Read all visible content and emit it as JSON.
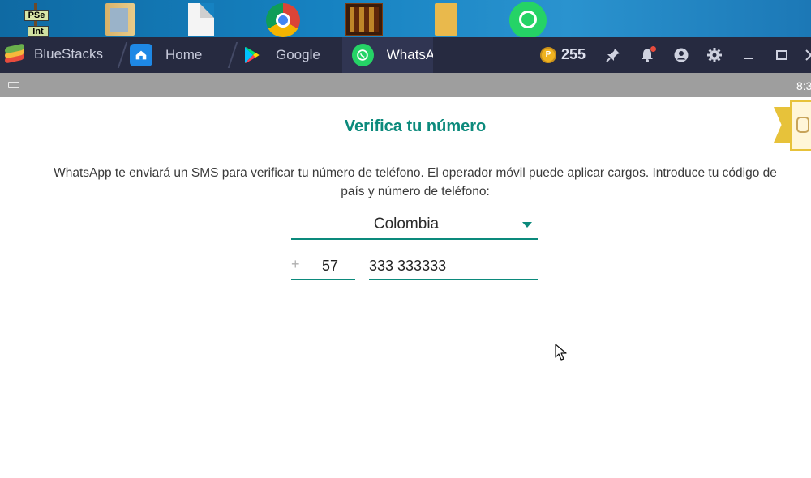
{
  "desktop": {
    "icons": [
      {
        "name": "pse-icon",
        "plate_top": "PSe",
        "plate_bottom": "Int"
      },
      {
        "name": "book-icon"
      },
      {
        "name": "file-icon"
      },
      {
        "name": "chrome-icon"
      },
      {
        "name": "game-icon"
      },
      {
        "name": "folder-icon"
      },
      {
        "name": "whatsapp-icon"
      }
    ]
  },
  "titlebar": {
    "app_name": "BlueStacks",
    "tabs": [
      {
        "label": "Home",
        "icon": "home-icon"
      },
      {
        "label": "Google",
        "icon": "play-store-icon"
      },
      {
        "label": "WhatsApp",
        "icon": "whatsapp-icon",
        "active": true
      }
    ],
    "coin_symbol": "P",
    "coins": "255",
    "icons": [
      "pin-icon",
      "bell-icon",
      "account-icon",
      "gear-icon",
      "minimize-icon",
      "maximize-icon",
      "close-icon"
    ]
  },
  "statusbar": {
    "clock": "8:3"
  },
  "screen": {
    "title": "Verifica tu número",
    "description_line1": "WhatsApp te enviará un SMS para verificar tu número de teléfono. El operador móvil puede aplicar cargos. Introduce tu código de",
    "description_line2": "país y número de teléfono:",
    "country": "Colombia",
    "plus_sign": "+",
    "country_code": "57",
    "phone_number": "333 333333"
  },
  "colors": {
    "accent": "#0c8a7c",
    "titlebar": "#262a40",
    "statusbar": "#9e9e9e"
  }
}
